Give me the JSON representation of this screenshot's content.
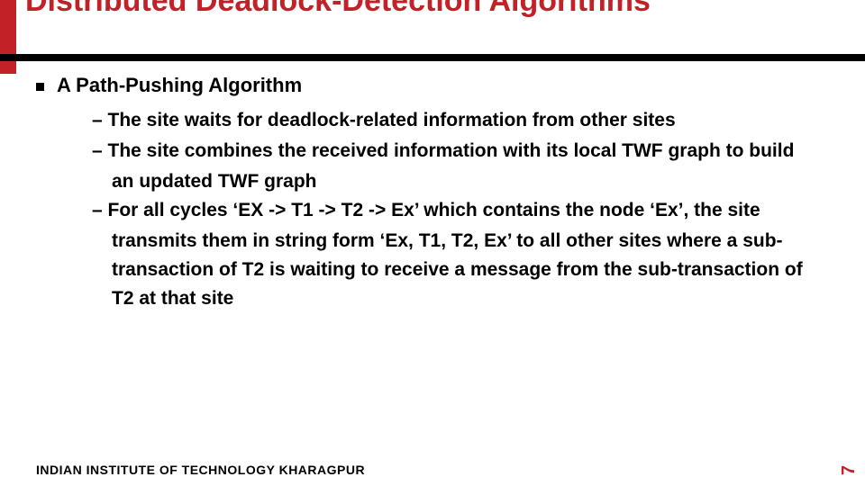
{
  "title": "Distributed Deadlock-Detection Algorithms",
  "bullet": "A Path-Pushing Algorithm",
  "items": {
    "d1": "–   The site waits for deadlock-related information from other sites",
    "d2": "–   The site combines the received information with its local TWF graph to build",
    "d2c": "an updated TWF graph",
    "d3": "–   For all cycles ‘EX -> T1 -> T2 -> Ex’ which contains the node ‘Ex’, the site",
    "d3c": "transmits them in string form ‘Ex, T1, T2, Ex’ to all other sites where a sub-transaction of T2 is waiting to receive a message from the sub-transaction of T2 at that site"
  },
  "footer": "INDIAN INSTITUTE OF TECHNOLOGY KHARAGPUR",
  "page": "7"
}
